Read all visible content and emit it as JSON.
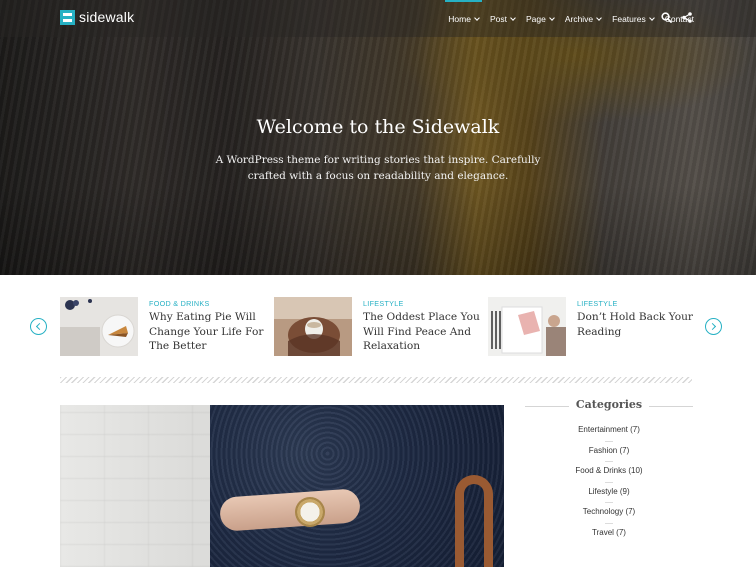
{
  "site": {
    "logo_text": "sidewalk"
  },
  "nav": {
    "items": [
      {
        "label": "Home",
        "dropdown": true,
        "active": true
      },
      {
        "label": "Post",
        "dropdown": true
      },
      {
        "label": "Page",
        "dropdown": true
      },
      {
        "label": "Archive",
        "dropdown": true
      },
      {
        "label": "Features",
        "dropdown": true
      },
      {
        "label": "Contact",
        "dropdown": false
      }
    ],
    "icons": [
      "search-icon",
      "share-icon"
    ]
  },
  "hero": {
    "title": "Welcome to the Sidewalk",
    "subtitle": "A WordPress theme for writing stories that inspire. Carefully crafted with a focus on readability and elegance."
  },
  "carousel": {
    "slides": [
      {
        "category": "Food & Drinks",
        "title": "Why Eating Pie Will Change Your Life For The Better"
      },
      {
        "category": "Lifestyle",
        "title": "The Oddest Place You Will Find Peace And Relaxation"
      },
      {
        "category": "Lifestyle",
        "title": "Don’t Hold Back Your Reading"
      }
    ]
  },
  "sidebar": {
    "categories_title": "Categories",
    "categories": [
      "Entertainment (7)",
      "Fashion (7)",
      "Food & Drinks (10)",
      "Lifestyle (9)",
      "Technology (7)",
      "Travel (7)"
    ]
  },
  "colors": {
    "accent": "#27b1c4",
    "text": "#333333"
  }
}
